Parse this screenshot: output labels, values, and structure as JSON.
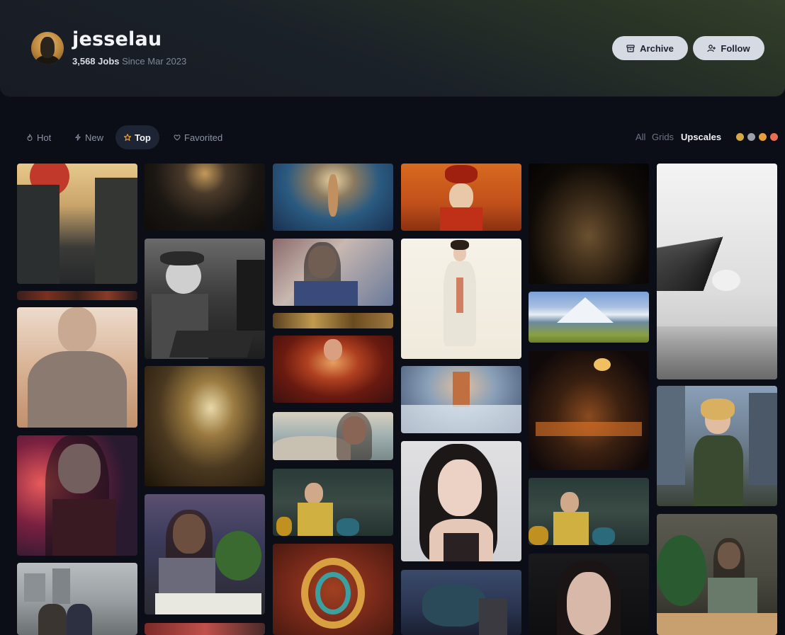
{
  "profile": {
    "username": "jesselau",
    "jobs": "3,568 Jobs",
    "since": "Since Mar 2023",
    "archive_label": "Archive",
    "follow_label": "Follow"
  },
  "tabs": [
    {
      "label": "Hot",
      "icon": "flame-icon"
    },
    {
      "label": "New",
      "icon": "lightning-icon"
    },
    {
      "label": "Top",
      "icon": "star-icon",
      "active": true
    },
    {
      "label": "Favorited",
      "icon": "heart-icon"
    }
  ],
  "filters": {
    "all": "All",
    "grids": "Grids",
    "upscales": "Upscales",
    "active": "Upscales"
  },
  "rating_icons": [
    "neutral-face-icon",
    "frown-face-icon",
    "smile-face-icon",
    "heart-eyes-face-icon"
  ],
  "gallery": {
    "columns": 6,
    "thumbnails": [
      {
        "subject": "japanese street with red sun"
      },
      {
        "subject": "dark crowd banner"
      },
      {
        "subject": "bald man with glasses in desert"
      },
      {
        "subject": "woman with dark hair and bokeh lights"
      },
      {
        "subject": "foggy city street with people"
      },
      {
        "subject": "dark hall with skulls"
      },
      {
        "subject": "boy at vintage computer"
      },
      {
        "subject": "golden theater interior"
      },
      {
        "subject": "girl at table with plants by window"
      },
      {
        "subject": "neon street strip"
      },
      {
        "subject": "goddess in fantasy sea"
      },
      {
        "subject": "girl in room with photos"
      },
      {
        "subject": "gold banner"
      },
      {
        "subject": "woman in red flames"
      },
      {
        "subject": "woman in sunglasses with car"
      },
      {
        "subject": "woman in yellow room"
      },
      {
        "subject": "colorful dragon"
      },
      {
        "subject": "woman with headdress orange background"
      },
      {
        "subject": "watercolor woman in white dress"
      },
      {
        "subject": "pagoda in snow"
      },
      {
        "subject": "portrait of woman with long hair"
      },
      {
        "subject": "dragon over castle"
      },
      {
        "subject": "dark city aerial"
      },
      {
        "subject": "mountain lake landscape"
      },
      {
        "subject": "night city with lanterns"
      },
      {
        "subject": "woman in yellow room duplicate"
      },
      {
        "subject": "close portrait of woman"
      },
      {
        "subject": "black and white eagle"
      },
      {
        "subject": "woman in city street"
      },
      {
        "subject": "woman with plants by window"
      }
    ]
  },
  "colors": {
    "background": "#0b0e17",
    "button_bg": "#d6dae3",
    "tab_active_bg": "#1d2433",
    "star_accent": "#f0a43c"
  }
}
